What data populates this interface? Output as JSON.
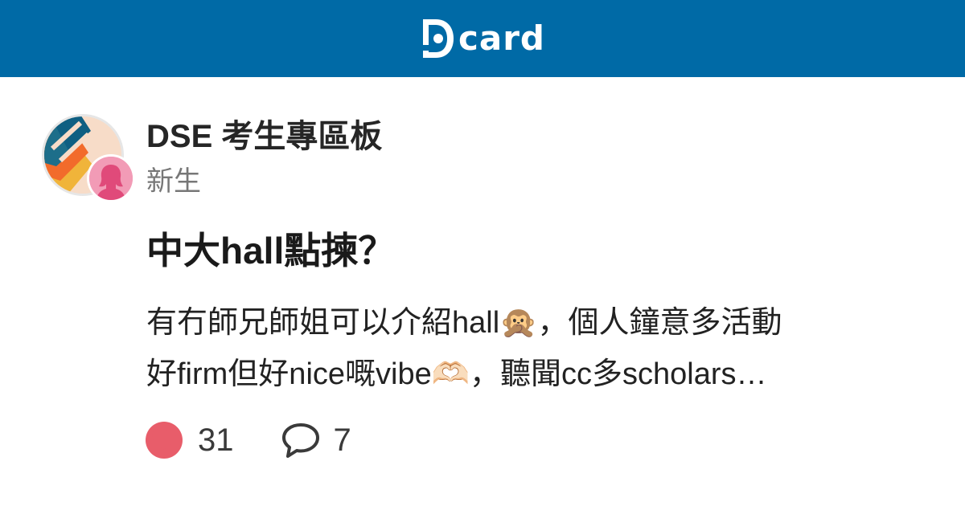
{
  "header": {
    "logo_text": "card",
    "logo_letter": "D",
    "bar_color": "#006aa6"
  },
  "board": {
    "name": "DSE 考生專區板",
    "avatar_icon": "board-avatar-icon"
  },
  "author": {
    "role": "新生",
    "avatar_icon": "female-user-avatar-icon"
  },
  "post": {
    "title": "中大hall點揀？",
    "excerpt_lines": [
      "有冇師兄師姐可以介紹hall🙊，個人鐘意多活動",
      "好firm但好nice嘅vibe🫶🏻，聽聞cc多scholars…"
    ]
  },
  "stats": {
    "likes": "31",
    "comments": "7",
    "like_icon": "heart-icon",
    "comment_icon": "comment-bubble-icon",
    "like_color": "#e85d6a"
  }
}
